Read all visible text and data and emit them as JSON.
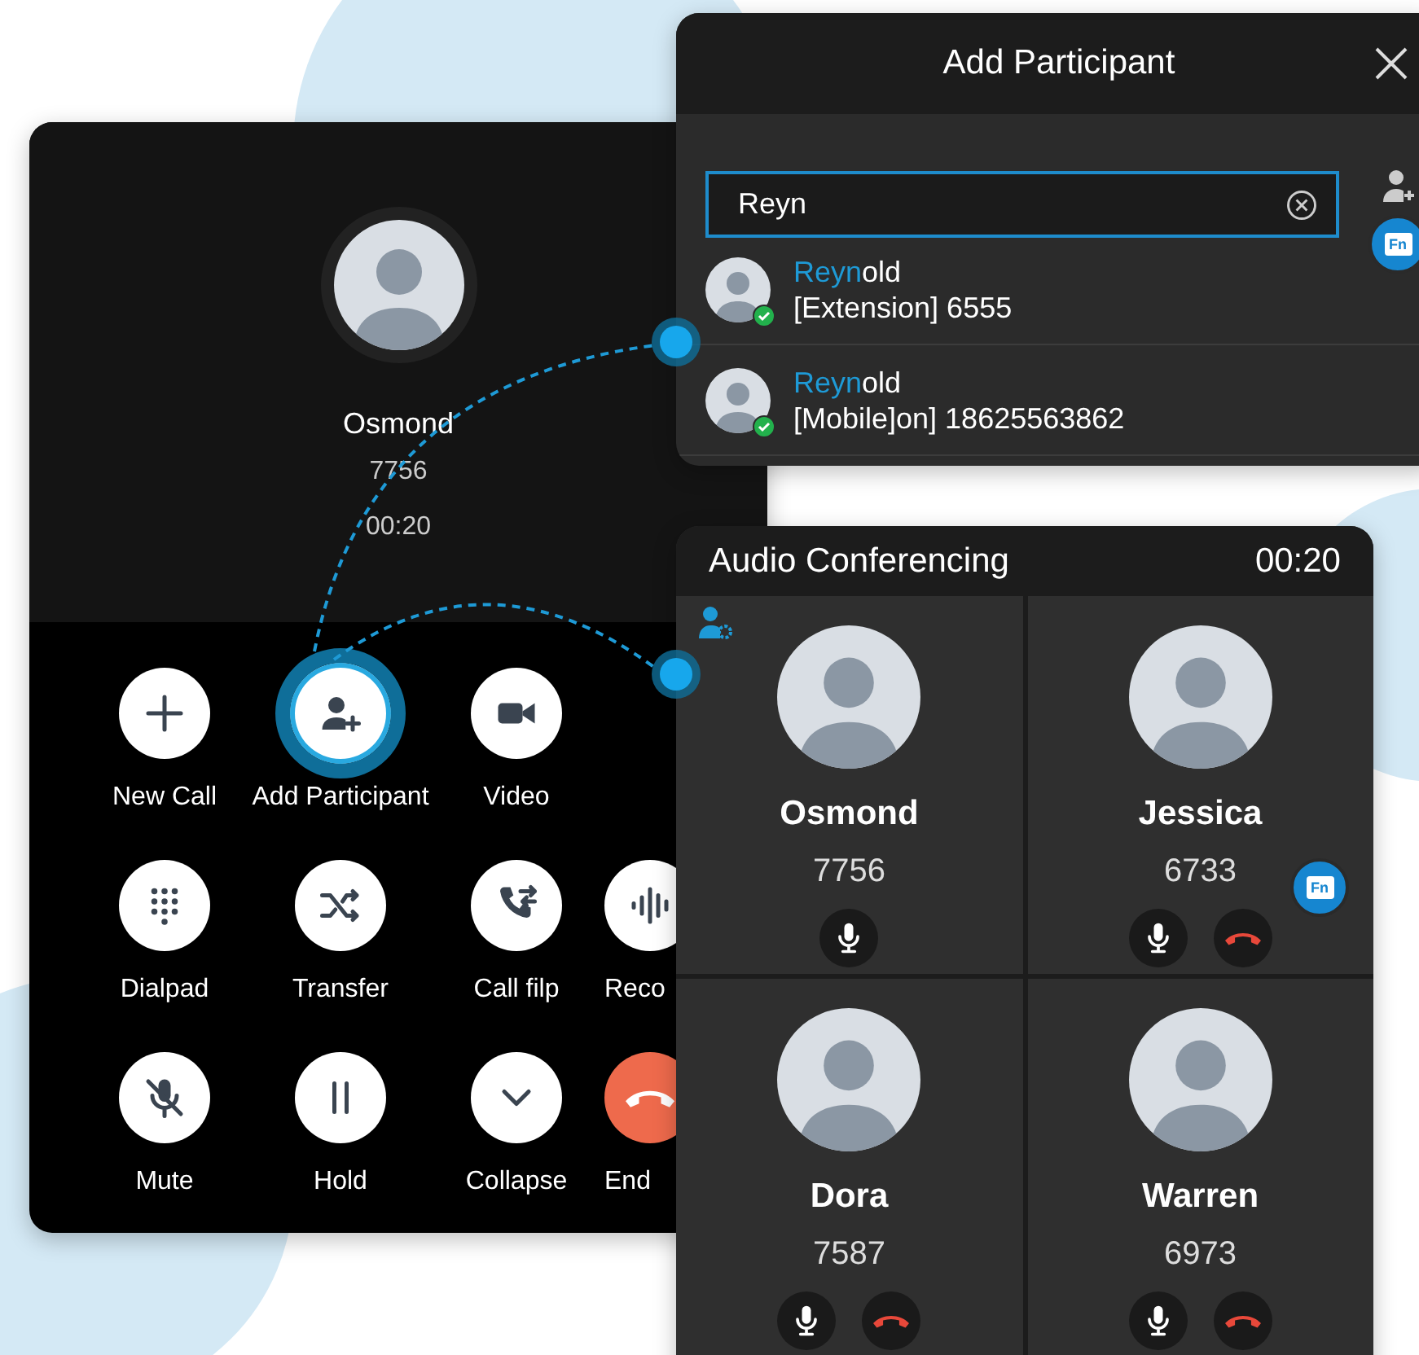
{
  "call": {
    "contact": {
      "name": "Osmond",
      "number": "7756",
      "duration": "00:20"
    },
    "action_rows": [
      [
        {
          "label": "New Call",
          "kind": "plus",
          "selected": false
        },
        {
          "label": "Add Participant",
          "kind": "person-add",
          "selected": true
        },
        {
          "label": "Video",
          "kind": "video",
          "selected": false
        }
      ],
      [
        {
          "label": "Dialpad",
          "kind": "dialpad",
          "selected": false
        },
        {
          "label": "Transfer",
          "kind": "shuffle",
          "selected": false
        },
        {
          "label": "Call filp",
          "kind": "call-flip",
          "selected": false
        },
        {
          "label": "Reco",
          "kind": "waveform",
          "selected": false
        }
      ],
      [
        {
          "label": "Mute",
          "kind": "mic-off",
          "selected": false
        },
        {
          "label": "Hold",
          "kind": "pause",
          "selected": false
        },
        {
          "label": "Collapse",
          "kind": "chevron",
          "selected": false
        },
        {
          "label": "End",
          "kind": "hangup",
          "selected": false
        }
      ]
    ]
  },
  "add_participant": {
    "title": "Add Participant",
    "search": {
      "value": "Reyn"
    },
    "fn_badge": "Fn",
    "results": [
      {
        "match": "Reyn",
        "rest": "old",
        "detail": "[Extension] 6555",
        "online": true
      },
      {
        "match": "Reyn",
        "rest": "old",
        "detail": "[Mobile]on] 18625563862",
        "online": true
      }
    ]
  },
  "conference": {
    "title": "Audio Conferencing",
    "timer": "00:20",
    "fn_badge": "Fn",
    "participants": [
      {
        "name": "Osmond",
        "number": "7756",
        "controls": [
          {
            "kind": "mic"
          }
        ]
      },
      {
        "name": "Jessica",
        "number": "6733",
        "controls": [
          {
            "kind": "mic"
          },
          {
            "kind": "hangup"
          }
        ]
      },
      {
        "name": "Dora",
        "number": "7587",
        "controls": [
          {
            "kind": "mic"
          },
          {
            "kind": "hangup"
          }
        ]
      },
      {
        "name": "Warren",
        "number": "6973",
        "controls": [
          {
            "kind": "mic"
          },
          {
            "kind": "hangup"
          }
        ]
      }
    ]
  }
}
